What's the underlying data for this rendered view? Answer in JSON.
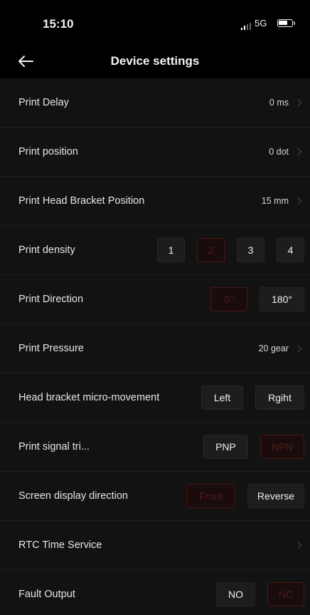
{
  "status": {
    "time": "15:10",
    "network": "5G"
  },
  "header": {
    "title": "Device settings",
    "back_icon": "arrow-left-icon"
  },
  "accent": {
    "selected_border": "#4b1717",
    "selected_text": "#4f1c1c"
  },
  "settings": [
    {
      "label": "Print Delay",
      "value": "0 ms"
    },
    {
      "label": "Print position",
      "value": "0 dot"
    },
    {
      "label": "Print Head Bracket Position",
      "value": "15 mm"
    },
    {
      "label": "Print density",
      "options": [
        "1",
        "2",
        "3",
        "4"
      ],
      "selected": "2"
    },
    {
      "label": "Print Direction",
      "options": [
        "0°",
        "180°"
      ],
      "selected": "0°"
    },
    {
      "label": "Print Pressure",
      "value": "20 gear"
    },
    {
      "label": "Head bracket micro-movement",
      "options": [
        "Left",
        "Rgiht"
      ],
      "selected": null
    },
    {
      "label": "Print signal tri...",
      "options": [
        "PNP",
        "NPN"
      ],
      "selected": "NPN"
    },
    {
      "label": "Screen display direction",
      "options": [
        "Front",
        "Reverse"
      ],
      "selected": "Front"
    },
    {
      "label": "RTC Time Service",
      "value": ""
    },
    {
      "label": "Fault Output",
      "options": [
        "NO",
        "NC"
      ],
      "selected": "NC"
    }
  ]
}
